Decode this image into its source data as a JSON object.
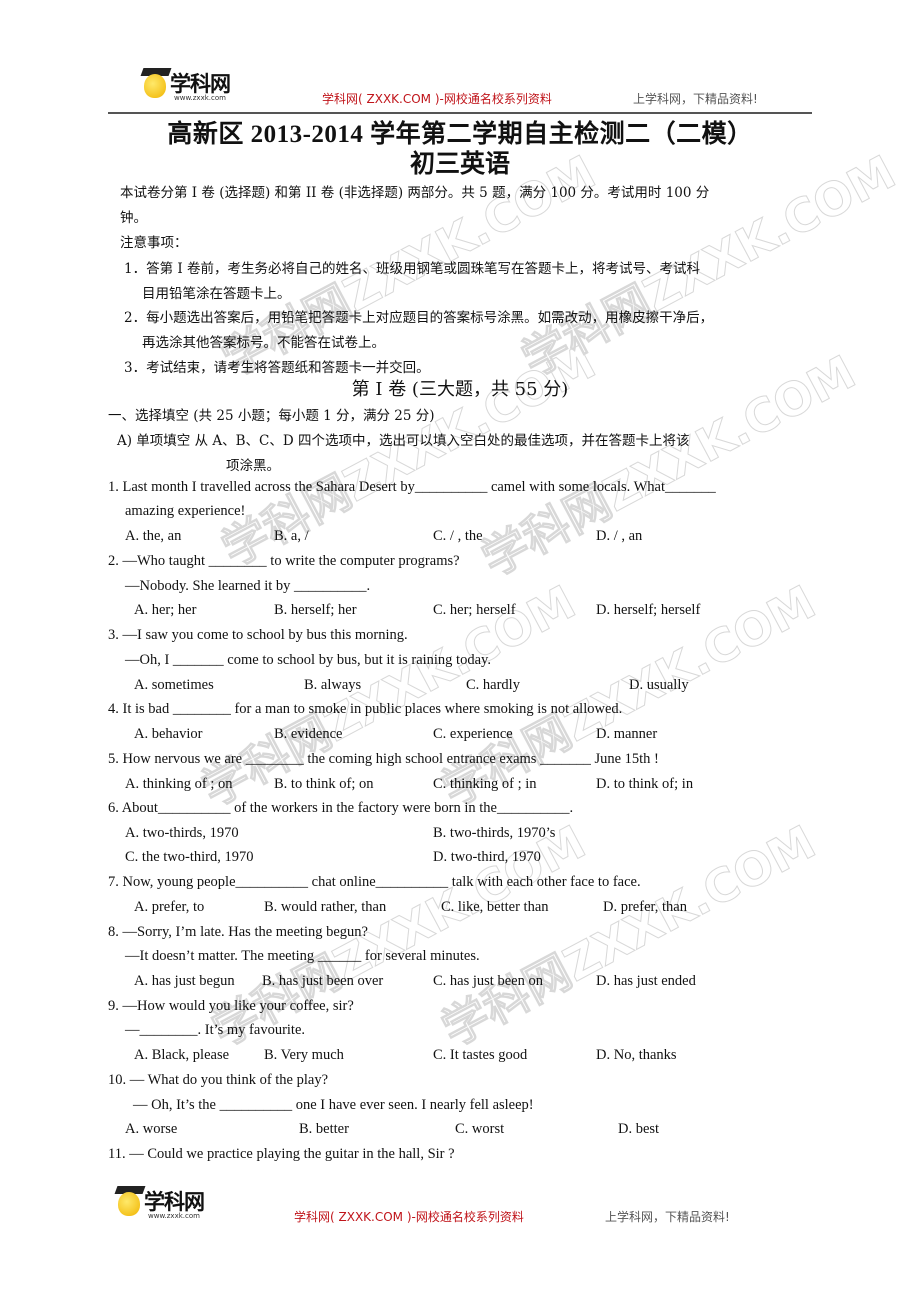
{
  "header": {
    "logo_name": "学科网",
    "logo_url": "www.zxxk.com",
    "slogan": "学科网( ZXXK.COM )-网校通名校系列资料",
    "tagline": "上学科网，下精品资料!"
  },
  "footer": {
    "logo_name": "学科网",
    "logo_url": "www.zxxk.com",
    "slogan": "学科网( ZXXK.COM )-网校通名校系列资料",
    "tagline": "上学科网，下精品资料!"
  },
  "watermark_text": "学科网ZXXK.COM",
  "document": {
    "title": "高新区 2013-2014 学年第二学期自主检测二（二模）",
    "subtitle": "初三英语",
    "intro_line1": "本试卷分第 I 卷 (选择题) 和第 II 卷 (非选择题) 两部分。共 5 题，满分 100 分。考试用时 100 分",
    "intro_line2": "钟。",
    "notes_heading": "注意事项：",
    "notes": [
      {
        "line1": "1．答第 I 卷前，考生务必将自己的姓名、班级用钢笔或圆珠笔写在答题卡上，将考试号、考试科",
        "line2": "目用铅笔涂在答题卡上。"
      },
      {
        "line1": "2．每小题选出答案后，用铅笔把答题卡上对应题目的答案标号涂黑。如需改动，用橡皮擦干净后，",
        "line2": "再选涂其他答案标号。不能答在试卷上。"
      },
      {
        "line1": "3．考试结束，请考生将答题纸和答题卡一并交回。",
        "line2": ""
      }
    ],
    "part_heading": "第 I 卷 (三大题，共 55 分)",
    "section1_heading": "一、选择填空 (共 25 小题；每小题 1 分，满分 25 分)",
    "sectionA_line1": "A)  单项填空   从 A、B、C、D 四个选项中，选出可以填入空白处的最佳选项，并在答题卡上将该",
    "sectionA_line2": "项涂黑。",
    "questions": [
      {
        "lines": [
          "1. Last month I travelled across the Sahara Desert by__________  camel with some locals. What_______",
          "amazing experience!"
        ],
        "options": [
          "A. the, an",
          "B. a, /",
          "C. / , the",
          "D. / , an"
        ]
      },
      {
        "lines": [
          "2. —Who taught ________ to write the computer programs?",
          "—Nobody. She learned it by __________."
        ],
        "options": [
          "A. her; her",
          "B. herself; her",
          "C. her; herself",
          "D. herself; herself"
        ]
      },
      {
        "lines": [
          "3. —I saw you come to school by bus this morning.",
          "—Oh, I _______ come to school by bus, but it is raining today."
        ],
        "options": [
          "A. sometimes",
          "B. always",
          "C. hardly",
          "D. usually"
        ]
      },
      {
        "lines": [
          "4. It is bad ________ for a man to smoke in public places where smoking is not allowed."
        ],
        "options": [
          "A. behavior",
          "B. evidence",
          "C. experience",
          "D. manner"
        ]
      },
      {
        "lines": [
          "5. How nervous we are ________ the coming high school entrance exams _______ June 15th !"
        ],
        "options": [
          "A. thinking of ; on",
          "B. to think of; on",
          "C. thinking of ; in",
          "D. to think of; in"
        ]
      },
      {
        "lines": [
          "6. About__________  of the workers in the factory were born in the__________."
        ],
        "options": [
          "A. two-thirds, 1970",
          "B. two-thirds, 1970’s",
          "C. the two-third, 1970",
          "D. two-third, 1970"
        ]
      },
      {
        "lines": [
          "7. Now, young people__________  chat online__________  talk with each other face to face."
        ],
        "options": [
          "A. prefer, to",
          "B. would rather, than",
          "C. like, better than",
          "D. prefer, than"
        ]
      },
      {
        "lines": [
          "8. —Sorry, I’m late. Has the meeting begun?",
          "—It doesn’t matter. The meeting  ______  for several minutes."
        ],
        "options": [
          "A. has just begun",
          "B. has just been over",
          "C. has just been on",
          "D. has just ended"
        ]
      },
      {
        "lines": [
          "9. —How would you like your coffee, sir?",
          "—________. It’s my favourite."
        ],
        "options": [
          "A. Black, please",
          "B. Very much",
          "C. It tastes good",
          "D. No, thanks"
        ]
      },
      {
        "lines": [
          "10. — What do you think of the play?",
          "— Oh, It’s the __________ one I have ever seen. I nearly fell asleep!"
        ],
        "options": [
          "A. worse",
          "B. better",
          "C. worst",
          "D. best"
        ]
      },
      {
        "lines": [
          "11. — Could we practice playing the guitar in the hall, Sir ?"
        ],
        "options": []
      }
    ]
  }
}
